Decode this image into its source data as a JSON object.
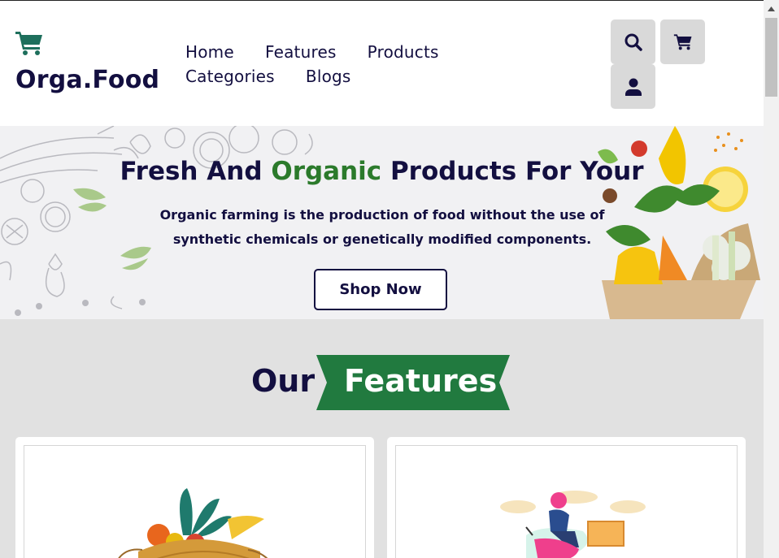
{
  "brand": {
    "name": "Orga.Food",
    "icon": "cart-icon"
  },
  "nav": {
    "items": [
      {
        "label": "Home"
      },
      {
        "label": "Features"
      },
      {
        "label": "Products"
      },
      {
        "label": "Categories"
      },
      {
        "label": "Blogs"
      }
    ]
  },
  "header_icons": [
    "search-icon",
    "cart-icon",
    "user-icon"
  ],
  "hero": {
    "title_part1": "Fresh And ",
    "title_accent": "Organic",
    "title_part2": " Products For Your",
    "text": "Organic farming is the production of food without the use of synthetic chemicals or genetically modified components.",
    "button": "Shop Now"
  },
  "features": {
    "heading_part1": "Our",
    "heading_part2": "Features",
    "cards": [
      {
        "image": "vegetable-basket-illustration"
      },
      {
        "image": "delivery-scooter-illustration"
      }
    ]
  },
  "colors": {
    "brand_dark": "#130f40",
    "accent_green": "#217a3f",
    "logo_green": "#27ae60"
  }
}
